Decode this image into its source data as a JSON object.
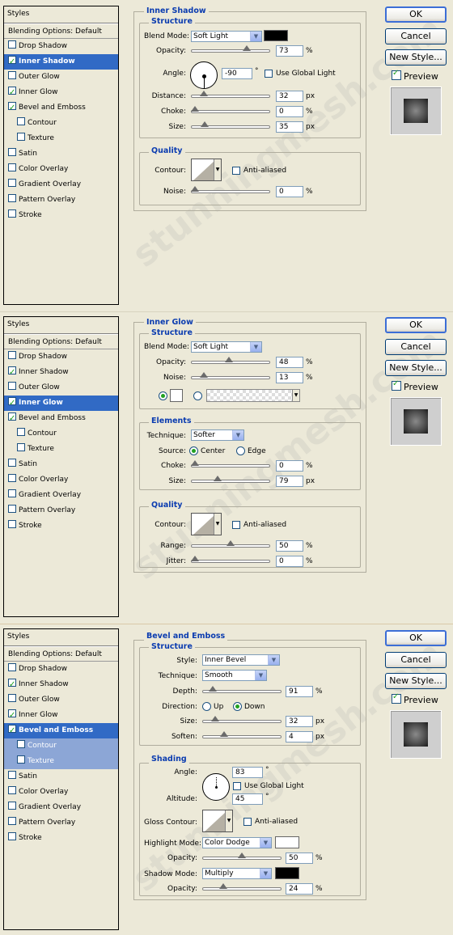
{
  "watermark": "stunningmesh.com",
  "buttons": {
    "ok": "OK",
    "cancel": "Cancel",
    "new_style": "New Style...",
    "preview": "Preview"
  },
  "styles_list": {
    "header": "Styles",
    "blending": "Blending Options: Default",
    "items": [
      "Drop Shadow",
      "Inner Shadow",
      "Outer Glow",
      "Inner Glow",
      "Bevel and Emboss",
      "Contour",
      "Texture",
      "Satin",
      "Color Overlay",
      "Gradient Overlay",
      "Pattern Overlay",
      "Stroke"
    ]
  },
  "colors": {
    "selection": "#316ac5",
    "sub_selection": "#8ca6d6",
    "group_title": "#0b3cb0",
    "check": "#21a121"
  },
  "panel1": {
    "checked": [
      false,
      true,
      false,
      true,
      true,
      false,
      false,
      false,
      false,
      false,
      false,
      false
    ],
    "section_title": "Inner Shadow",
    "structure_title": "Structure",
    "blend_mode_label": "Blend Mode:",
    "blend_mode": "Soft Light",
    "blend_color": "#000000",
    "opacity_label": "Opacity:",
    "opacity": "73",
    "pct": "%",
    "angle_label": "Angle:",
    "angle": "-90",
    "degree": "°",
    "use_global_light": "Use Global Light",
    "distance_label": "Distance:",
    "distance": "32",
    "px": "px",
    "choke_label": "Choke:",
    "choke": "0",
    "size_label": "Size:",
    "size": "35",
    "quality_title": "Quality",
    "contour_label": "Contour:",
    "anti_aliased": "Anti-aliased",
    "noise_label": "Noise:",
    "noise": "0",
    "sliders": {
      "opacity": 0.73,
      "distance": 0.13,
      "choke": 0.0,
      "size": 0.14,
      "noise": 0.0
    }
  },
  "panel2": {
    "checked": [
      false,
      true,
      false,
      true,
      true,
      false,
      false,
      false,
      false,
      false,
      false,
      false
    ],
    "section_title": "Inner Glow",
    "structure_title": "Structure",
    "blend_mode_label": "Blend Mode:",
    "blend_mode": "Soft Light",
    "opacity_label": "Opacity:",
    "opacity": "48",
    "pct": "%",
    "noise_label": "Noise:",
    "noise": "13",
    "elements_title": "Elements",
    "technique_label": "Technique:",
    "technique": "Softer",
    "source_label": "Source:",
    "source_center": "Center",
    "source_edge": "Edge",
    "choke_label": "Choke:",
    "choke": "0",
    "size_label": "Size:",
    "size": "79",
    "px": "px",
    "quality_title": "Quality",
    "contour_label": "Contour:",
    "anti_aliased": "Anti-aliased",
    "range_label": "Range:",
    "range": "50",
    "jitter_label": "Jitter:",
    "jitter": "0",
    "sliders": {
      "opacity": 0.48,
      "noise": 0.13,
      "choke": 0.0,
      "size": 0.32,
      "range": 0.5,
      "jitter": 0.0
    }
  },
  "panel3": {
    "checked": [
      false,
      true,
      false,
      true,
      true,
      false,
      false,
      false,
      false,
      false,
      false,
      false
    ],
    "section_title": "Bevel and Emboss",
    "structure_title": "Structure",
    "style_label": "Style:",
    "style": "Inner Bevel",
    "technique_label": "Technique:",
    "technique": "Smooth",
    "depth_label": "Depth:",
    "depth": "91",
    "pct": "%",
    "direction_label": "Direction:",
    "dir_up": "Up",
    "dir_down": "Down",
    "size_label": "Size:",
    "size": "32",
    "px": "px",
    "soften_label": "Soften:",
    "soften": "4",
    "shading_title": "Shading",
    "angle_label": "Angle:",
    "angle": "83",
    "degree": "°",
    "use_global_light": "Use Global Light",
    "altitude_label": "Altitude:",
    "altitude": "45",
    "gloss_label": "Gloss Contour:",
    "anti_aliased": "Anti-aliased",
    "highlight_label": "Highlight Mode:",
    "highlight_mode": "Color Dodge",
    "highlight_color": "#ffffff",
    "h_opacity_label": "Opacity:",
    "h_opacity": "50",
    "shadow_label": "Shadow Mode:",
    "shadow_mode": "Multiply",
    "shadow_color": "#000000",
    "s_opacity_label": "Opacity:",
    "s_opacity": "24",
    "sliders": {
      "depth": 0.09,
      "size": 0.13,
      "soften": 0.25,
      "h_opacity": 0.5,
      "s_opacity": 0.24
    }
  }
}
